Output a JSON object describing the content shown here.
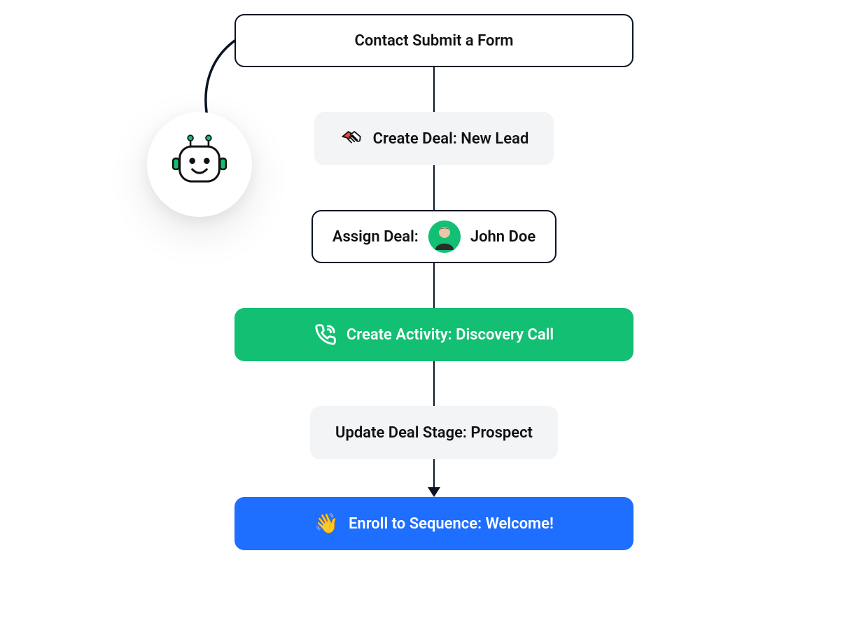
{
  "flow": {
    "trigger": {
      "label": "Contact Submit a Form"
    },
    "steps": [
      {
        "key": "create_deal",
        "label": "Create Deal: New Lead",
        "style": "gray",
        "icon": "handshake-icon"
      },
      {
        "key": "assign_deal",
        "label_pre": "Assign Deal:",
        "assignee": "John Doe",
        "style": "assign",
        "icon": "avatar"
      },
      {
        "key": "create_activity",
        "label": "Create Activity: Discovery Call",
        "style": "green",
        "icon": "phone-icon"
      },
      {
        "key": "update_stage",
        "label": "Update Deal Stage: Prospect",
        "style": "gray"
      },
      {
        "key": "enroll_sequence",
        "label": "Enroll to Sequence: Welcome!",
        "style": "blue",
        "icon": "wave-icon"
      }
    ]
  },
  "robot": {
    "name": "automation-bot-icon"
  },
  "colors": {
    "green": "#13bf72",
    "blue": "#1e6eff",
    "gray": "#f2f4f6",
    "outline": "#0b1426"
  }
}
